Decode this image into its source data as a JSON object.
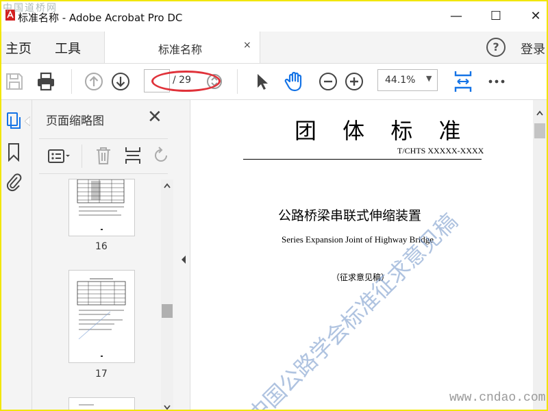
{
  "window": {
    "title": "标准名称 - Adobe Acrobat Pro DC",
    "corner_watermark": "中国道桥网",
    "minimize": "—",
    "maximize": "☐",
    "close": "✕"
  },
  "menubar": {
    "home": "主页",
    "tools": "工具",
    "tab_label": "标准名称",
    "tab_close": "×",
    "help": "?",
    "login": "登录"
  },
  "toolbar": {
    "page_current": "",
    "page_total": "/ 29",
    "zoom": "44.1%"
  },
  "thumbnails": {
    "title": "页面缩略图",
    "close": "✕",
    "pages": [
      "16",
      "17"
    ]
  },
  "document": {
    "title": "团 体 标 准",
    "code": "T/CHTS XXXXX-XXXX",
    "title_cn": "公路桥梁串联式伸缩装置",
    "title_en": "Series Expansion Joint of Highway Bridge",
    "draft": "（征求意见稿）",
    "watermark": "中国公路学会标准征求意见稿"
  },
  "footer": {
    "site": "www.cndao.com"
  }
}
